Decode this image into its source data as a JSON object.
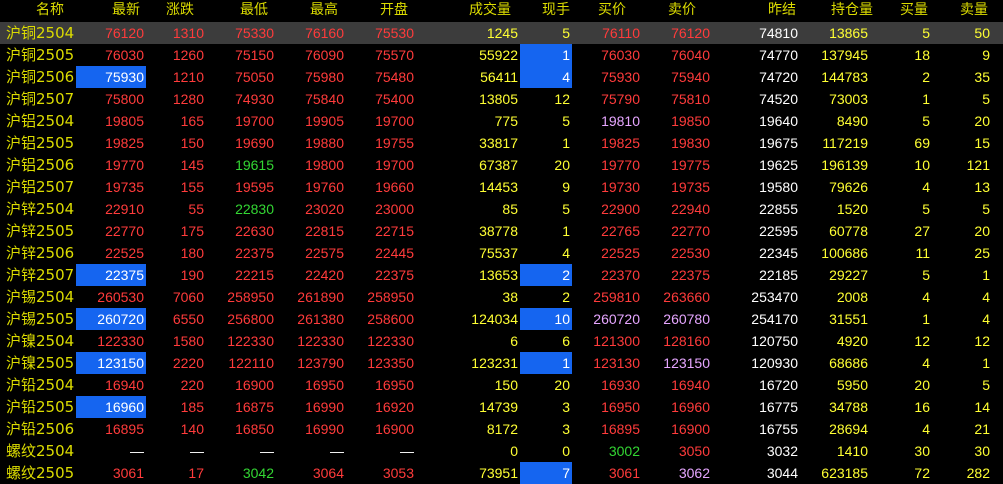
{
  "colors": {
    "background": "#000000",
    "header": "#dcdc00",
    "name": "#dcdc00",
    "red": "#ff3b3b",
    "green": "#33d633",
    "white": "#ffffff",
    "yellow": "#ffff33",
    "violet": "#e6a6ff",
    "highlight": "#1565f0",
    "selected_row": "#3c3c3c"
  },
  "columns": [
    "名称",
    "最新",
    "涨跌",
    "最低",
    "最高",
    "开盘",
    "成交量",
    "现手",
    "买价",
    "卖价",
    "昨结",
    "持仓量",
    "买量",
    "卖量"
  ],
  "rows": [
    {
      "name": "沪铜2504",
      "last": "76120",
      "chg": "1310",
      "low": "75330",
      "high": "76160",
      "open": "75530",
      "vol": "1245",
      "cur": "5",
      "bid": "76110",
      "ask": "76120",
      "prev": "74810",
      "oi": "13865",
      "bq": "5",
      "aq": "50",
      "c": {
        "last": "red",
        "chg": "red",
        "low": "red",
        "high": "red",
        "open": "red",
        "bid": "red",
        "ask": "red"
      },
      "hl": {}
    },
    {
      "name": "沪铜2505",
      "last": "76030",
      "chg": "1260",
      "low": "75150",
      "high": "76090",
      "open": "75570",
      "vol": "55922",
      "cur": "1",
      "bid": "76030",
      "ask": "76040",
      "prev": "74770",
      "oi": "137945",
      "bq": "18",
      "aq": "9",
      "c": {
        "last": "red",
        "chg": "red",
        "low": "red",
        "high": "red",
        "open": "red",
        "bid": "red",
        "ask": "red"
      },
      "hl": {
        "cur": true
      }
    },
    {
      "name": "沪铜2506",
      "last": "75930",
      "chg": "1210",
      "low": "75050",
      "high": "75980",
      "open": "75480",
      "vol": "56411",
      "cur": "4",
      "bid": "75930",
      "ask": "75940",
      "prev": "74720",
      "oi": "144783",
      "bq": "2",
      "aq": "35",
      "c": {
        "last": "red",
        "chg": "red",
        "low": "red",
        "high": "red",
        "open": "red",
        "bid": "red",
        "ask": "red"
      },
      "hl": {
        "last": true,
        "cur": true
      }
    },
    {
      "name": "沪铜2507",
      "last": "75800",
      "chg": "1280",
      "low": "74930",
      "high": "75840",
      "open": "75400",
      "vol": "13805",
      "cur": "12",
      "bid": "75790",
      "ask": "75810",
      "prev": "74520",
      "oi": "73003",
      "bq": "1",
      "aq": "5",
      "c": {
        "last": "red",
        "chg": "red",
        "low": "red",
        "high": "red",
        "open": "red",
        "bid": "red",
        "ask": "red"
      },
      "hl": {}
    },
    {
      "name": "沪铝2504",
      "last": "19805",
      "chg": "165",
      "low": "19700",
      "high": "19905",
      "open": "19700",
      "vol": "775",
      "cur": "5",
      "bid": "19810",
      "ask": "19850",
      "prev": "19640",
      "oi": "8490",
      "bq": "5",
      "aq": "20",
      "c": {
        "last": "red",
        "chg": "red",
        "low": "red",
        "high": "red",
        "open": "red",
        "bid": "violet",
        "ask": "red"
      },
      "hl": {}
    },
    {
      "name": "沪铝2505",
      "last": "19825",
      "chg": "150",
      "low": "19690",
      "high": "19880",
      "open": "19755",
      "vol": "33817",
      "cur": "1",
      "bid": "19825",
      "ask": "19830",
      "prev": "19675",
      "oi": "117219",
      "bq": "69",
      "aq": "15",
      "c": {
        "last": "red",
        "chg": "red",
        "low": "red",
        "high": "red",
        "open": "red",
        "bid": "red",
        "ask": "red"
      },
      "hl": {}
    },
    {
      "name": "沪铝2506",
      "last": "19770",
      "chg": "145",
      "low": "19615",
      "high": "19800",
      "open": "19700",
      "vol": "67387",
      "cur": "20",
      "bid": "19770",
      "ask": "19775",
      "prev": "19625",
      "oi": "196139",
      "bq": "10",
      "aq": "121",
      "c": {
        "last": "red",
        "chg": "red",
        "low": "green",
        "high": "red",
        "open": "red",
        "bid": "red",
        "ask": "red"
      },
      "hl": {}
    },
    {
      "name": "沪铝2507",
      "last": "19735",
      "chg": "155",
      "low": "19595",
      "high": "19760",
      "open": "19660",
      "vol": "14453",
      "cur": "9",
      "bid": "19730",
      "ask": "19735",
      "prev": "19580",
      "oi": "79626",
      "bq": "4",
      "aq": "13",
      "c": {
        "last": "red",
        "chg": "red",
        "low": "red",
        "high": "red",
        "open": "red",
        "bid": "red",
        "ask": "red"
      },
      "hl": {}
    },
    {
      "name": "沪锌2504",
      "last": "22910",
      "chg": "55",
      "low": "22830",
      "high": "23020",
      "open": "23000",
      "vol": "85",
      "cur": "5",
      "bid": "22900",
      "ask": "22940",
      "prev": "22855",
      "oi": "1520",
      "bq": "5",
      "aq": "5",
      "c": {
        "last": "red",
        "chg": "red",
        "low": "green",
        "high": "red",
        "open": "red",
        "bid": "red",
        "ask": "red"
      },
      "hl": {}
    },
    {
      "name": "沪锌2505",
      "last": "22770",
      "chg": "175",
      "low": "22630",
      "high": "22815",
      "open": "22715",
      "vol": "38778",
      "cur": "1",
      "bid": "22765",
      "ask": "22770",
      "prev": "22595",
      "oi": "60778",
      "bq": "27",
      "aq": "20",
      "c": {
        "last": "red",
        "chg": "red",
        "low": "red",
        "high": "red",
        "open": "red",
        "bid": "red",
        "ask": "red"
      },
      "hl": {}
    },
    {
      "name": "沪锌2506",
      "last": "22525",
      "chg": "180",
      "low": "22375",
      "high": "22575",
      "open": "22445",
      "vol": "75537",
      "cur": "4",
      "bid": "22525",
      "ask": "22530",
      "prev": "22345",
      "oi": "100686",
      "bq": "11",
      "aq": "25",
      "c": {
        "last": "red",
        "chg": "red",
        "low": "red",
        "high": "red",
        "open": "red",
        "bid": "red",
        "ask": "red"
      },
      "hl": {}
    },
    {
      "name": "沪锌2507",
      "last": "22375",
      "chg": "190",
      "low": "22215",
      "high": "22420",
      "open": "22375",
      "vol": "13653",
      "cur": "2",
      "bid": "22370",
      "ask": "22375",
      "prev": "22185",
      "oi": "29227",
      "bq": "5",
      "aq": "1",
      "c": {
        "last": "red",
        "chg": "red",
        "low": "red",
        "high": "red",
        "open": "red",
        "bid": "red",
        "ask": "red"
      },
      "hl": {
        "last": true,
        "cur": true
      }
    },
    {
      "name": "沪锡2504",
      "last": "260530",
      "chg": "7060",
      "low": "258950",
      "high": "261890",
      "open": "258950",
      "vol": "38",
      "cur": "2",
      "bid": "259810",
      "ask": "263660",
      "prev": "253470",
      "oi": "2008",
      "bq": "4",
      "aq": "4",
      "c": {
        "last": "red",
        "chg": "red",
        "low": "red",
        "high": "red",
        "open": "red",
        "bid": "red",
        "ask": "red"
      },
      "hl": {}
    },
    {
      "name": "沪锡2505",
      "last": "260720",
      "chg": "6550",
      "low": "256800",
      "high": "261380",
      "open": "258600",
      "vol": "124034",
      "cur": "10",
      "bid": "260720",
      "ask": "260780",
      "prev": "254170",
      "oi": "31551",
      "bq": "1",
      "aq": "4",
      "c": {
        "last": "red",
        "chg": "red",
        "low": "red",
        "high": "red",
        "open": "red",
        "bid": "violet",
        "ask": "violet"
      },
      "hl": {
        "last": true,
        "cur": true
      }
    },
    {
      "name": "沪镍2504",
      "last": "122330",
      "chg": "1580",
      "low": "122330",
      "high": "122330",
      "open": "122330",
      "vol": "6",
      "cur": "6",
      "bid": "121300",
      "ask": "128160",
      "prev": "120750",
      "oi": "4920",
      "bq": "12",
      "aq": "12",
      "c": {
        "last": "red",
        "chg": "red",
        "low": "red",
        "high": "red",
        "open": "red",
        "bid": "red",
        "ask": "red"
      },
      "hl": {}
    },
    {
      "name": "沪镍2505",
      "last": "123150",
      "chg": "2220",
      "low": "122110",
      "high": "123790",
      "open": "123350",
      "vol": "123231",
      "cur": "1",
      "bid": "123130",
      "ask": "123150",
      "prev": "120930",
      "oi": "68686",
      "bq": "4",
      "aq": "1",
      "c": {
        "last": "red",
        "chg": "red",
        "low": "red",
        "high": "red",
        "open": "red",
        "bid": "red",
        "ask": "violet"
      },
      "hl": {
        "last": true,
        "cur": true
      }
    },
    {
      "name": "沪铅2504",
      "last": "16940",
      "chg": "220",
      "low": "16900",
      "high": "16950",
      "open": "16950",
      "vol": "150",
      "cur": "20",
      "bid": "16930",
      "ask": "16940",
      "prev": "16720",
      "oi": "5950",
      "bq": "20",
      "aq": "5",
      "c": {
        "last": "red",
        "chg": "red",
        "low": "red",
        "high": "red",
        "open": "red",
        "bid": "red",
        "ask": "red"
      },
      "hl": {}
    },
    {
      "name": "沪铅2505",
      "last": "16960",
      "chg": "185",
      "low": "16875",
      "high": "16990",
      "open": "16920",
      "vol": "14739",
      "cur": "3",
      "bid": "16950",
      "ask": "16960",
      "prev": "16775",
      "oi": "34788",
      "bq": "16",
      "aq": "14",
      "c": {
        "last": "red",
        "chg": "red",
        "low": "red",
        "high": "red",
        "open": "red",
        "bid": "red",
        "ask": "red"
      },
      "hl": {
        "last": true
      }
    },
    {
      "name": "沪铅2506",
      "last": "16895",
      "chg": "140",
      "low": "16850",
      "high": "16990",
      "open": "16900",
      "vol": "8172",
      "cur": "3",
      "bid": "16895",
      "ask": "16900",
      "prev": "16755",
      "oi": "28694",
      "bq": "4",
      "aq": "21",
      "c": {
        "last": "red",
        "chg": "red",
        "low": "red",
        "high": "red",
        "open": "red",
        "bid": "red",
        "ask": "red"
      },
      "hl": {}
    },
    {
      "name": "螺纹2504",
      "last": "—",
      "chg": "—",
      "low": "—",
      "high": "—",
      "open": "—",
      "vol": "0",
      "cur": "0",
      "bid": "3002",
      "ask": "3050",
      "prev": "3032",
      "oi": "1410",
      "bq": "30",
      "aq": "30",
      "c": {
        "last": "white",
        "chg": "white",
        "low": "white",
        "high": "white",
        "open": "white",
        "bid": "green",
        "ask": "red"
      },
      "hl": {}
    },
    {
      "name": "螺纹2505",
      "last": "3061",
      "chg": "17",
      "low": "3042",
      "high": "3064",
      "open": "3053",
      "vol": "73951",
      "cur": "7",
      "bid": "3061",
      "ask": "3062",
      "prev": "3044",
      "oi": "623185",
      "bq": "72",
      "aq": "282",
      "c": {
        "last": "red",
        "chg": "red",
        "low": "green",
        "high": "red",
        "open": "red",
        "bid": "red",
        "ask": "violet"
      },
      "hl": {
        "cur": true
      }
    }
  ]
}
